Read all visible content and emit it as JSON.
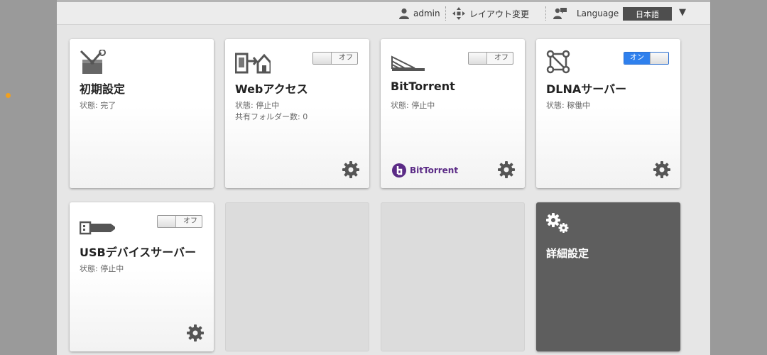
{
  "header": {
    "user": "admin",
    "layout_change": "レイアウト変更",
    "language_label": "Language",
    "language_value": "日本語"
  },
  "cards": [
    {
      "title": "初期設定",
      "status": "状態: 完了",
      "icon": "toolbox-icon"
    },
    {
      "title": "Webアクセス",
      "status": "状態: 停止中",
      "status2": "共有フォルダー数: 0",
      "toggle": "オフ",
      "icon": "web-access-icon"
    },
    {
      "title": "BitTorrent",
      "status": "状態: 停止中",
      "toggle": "オフ",
      "logo": "BitTorrent",
      "icon": "bittorrent-icon"
    },
    {
      "title": "DLNAサーバー",
      "status": "状態: 稼働中",
      "toggle": "オン",
      "icon": "dlna-network-icon"
    },
    {
      "title": "USBデバイスサーバー",
      "status": "状態: 停止中",
      "toggle": "オフ",
      "icon": "usb-icon"
    },
    {
      "title": "詳細設定",
      "icon": "gears-icon"
    }
  ],
  "colors": {
    "toggle_on": "#2f80ed",
    "bittorrent_purple": "#5b2b86",
    "dark_tile": "#5e5e5e",
    "accent_dot": "#f0a020"
  }
}
